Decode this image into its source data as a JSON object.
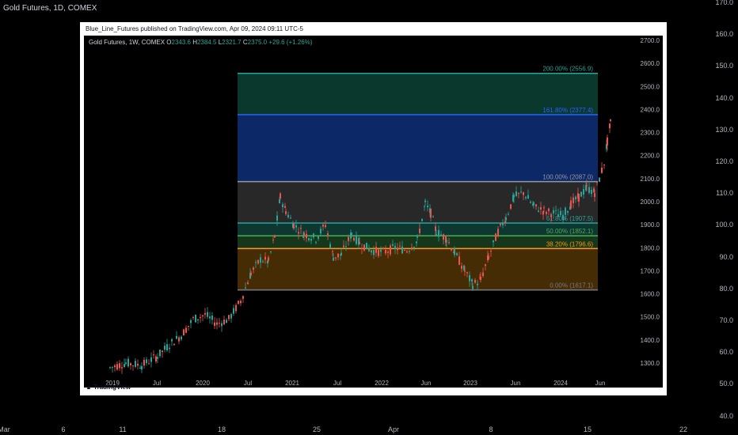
{
  "outer": {
    "title": "Gold Futures, 1D, COMEX",
    "y_ticks": [
      "170.0",
      "160.0",
      "150.0",
      "140.0",
      "130.0",
      "120.0",
      "110.0",
      "100.0",
      "90.0",
      "80.0",
      "70.0",
      "60.0",
      "50.0",
      "40.0"
    ],
    "x_ticks": [
      "Mar",
      "6",
      "11",
      "18",
      "25",
      "Apr",
      "8",
      "15",
      "22"
    ]
  },
  "card": {
    "header": "Blue_Line_Futures published on TradingView.com, Apr 09, 2024 09:11 UTC-5",
    "footer_brand": "TradingView"
  },
  "chart": {
    "symbol": "Gold Futures, 1W, COMEX",
    "ohlc": {
      "o_label": "O",
      "o": "2343.6",
      "h_label": "H",
      "h": "2384.5",
      "l_label": "L",
      "l": "2321.7",
      "c_label": "C",
      "c": "2375.0",
      "change": "+29.6 (+1.26%)"
    },
    "y_ticks": [
      "2700.0",
      "2600.0",
      "2500.0",
      "2400.0",
      "2300.0",
      "2200.0",
      "2100.0",
      "2000.0",
      "1900.0",
      "1800.0",
      "1700.0",
      "1600.0",
      "1500.0",
      "1400.0",
      "1300.0"
    ],
    "x_ticks": [
      "2019",
      "Jul",
      "2020",
      "Jul",
      "2021",
      "Jul",
      "2022",
      "Jun",
      "2023",
      "Jun",
      "2024",
      "Jun"
    ],
    "fib_levels": [
      {
        "label": "200.00% (2556.9)",
        "value": 2556.9,
        "color": "#26a69a"
      },
      {
        "label": "161.80% (2377.4)",
        "value": 2377.4,
        "color": "#2962ff"
      },
      {
        "label": "100.00% (2087.0)",
        "value": 2087.0,
        "color": "#9598a1"
      },
      {
        "label": "61.80% (1907.5)",
        "value": 1907.5,
        "color": "#26a69a"
      },
      {
        "label": "50.00% (1852.1)",
        "value": 1852.1,
        "color": "#4caf50"
      },
      {
        "label": "38.20% (1796.6)",
        "value": 1796.6,
        "color": "#ff9800"
      },
      {
        "label": "0.00% (1617.1)",
        "value": 1617.1,
        "color": "#787b86"
      }
    ],
    "colors": {
      "up": "#26a69a",
      "down": "#ef5350"
    }
  }
}
